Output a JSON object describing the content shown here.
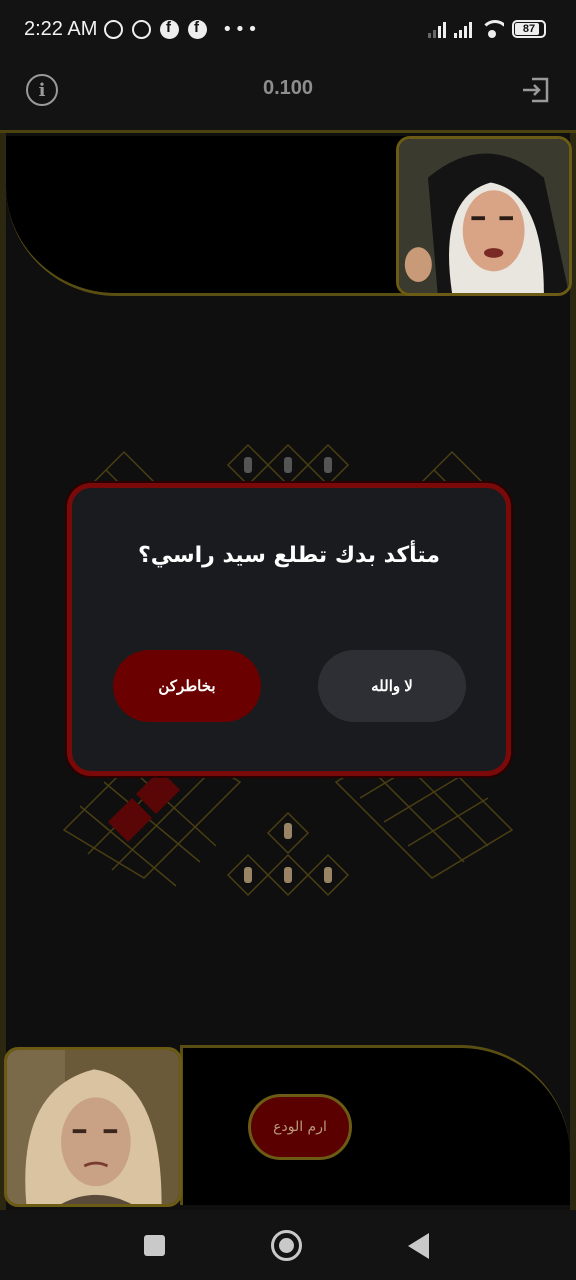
{
  "status_bar": {
    "time": "2:22 AM",
    "battery": "87",
    "icons": [
      "alarm-icon",
      "whatsapp-icon",
      "facebook-icon",
      "facebook-icon",
      "more-dots-icon",
      "signal-icon",
      "signal-icon",
      "wifi-icon",
      "battery-icon"
    ]
  },
  "header": {
    "score": "0.100",
    "info_icon": "info-icon",
    "exit_icon": "exit-icon"
  },
  "dialog": {
    "title": "متأكد بدك تطلع سيد راسي؟",
    "confirm_label": "بخاطركن",
    "cancel_label": "لا والله"
  },
  "game": {
    "throw_button_label": "ارم الودع"
  },
  "colors": {
    "accent_red": "#6a0000",
    "border_gold": "#6b5b14",
    "dialog_bg": "#1a1b1f"
  }
}
